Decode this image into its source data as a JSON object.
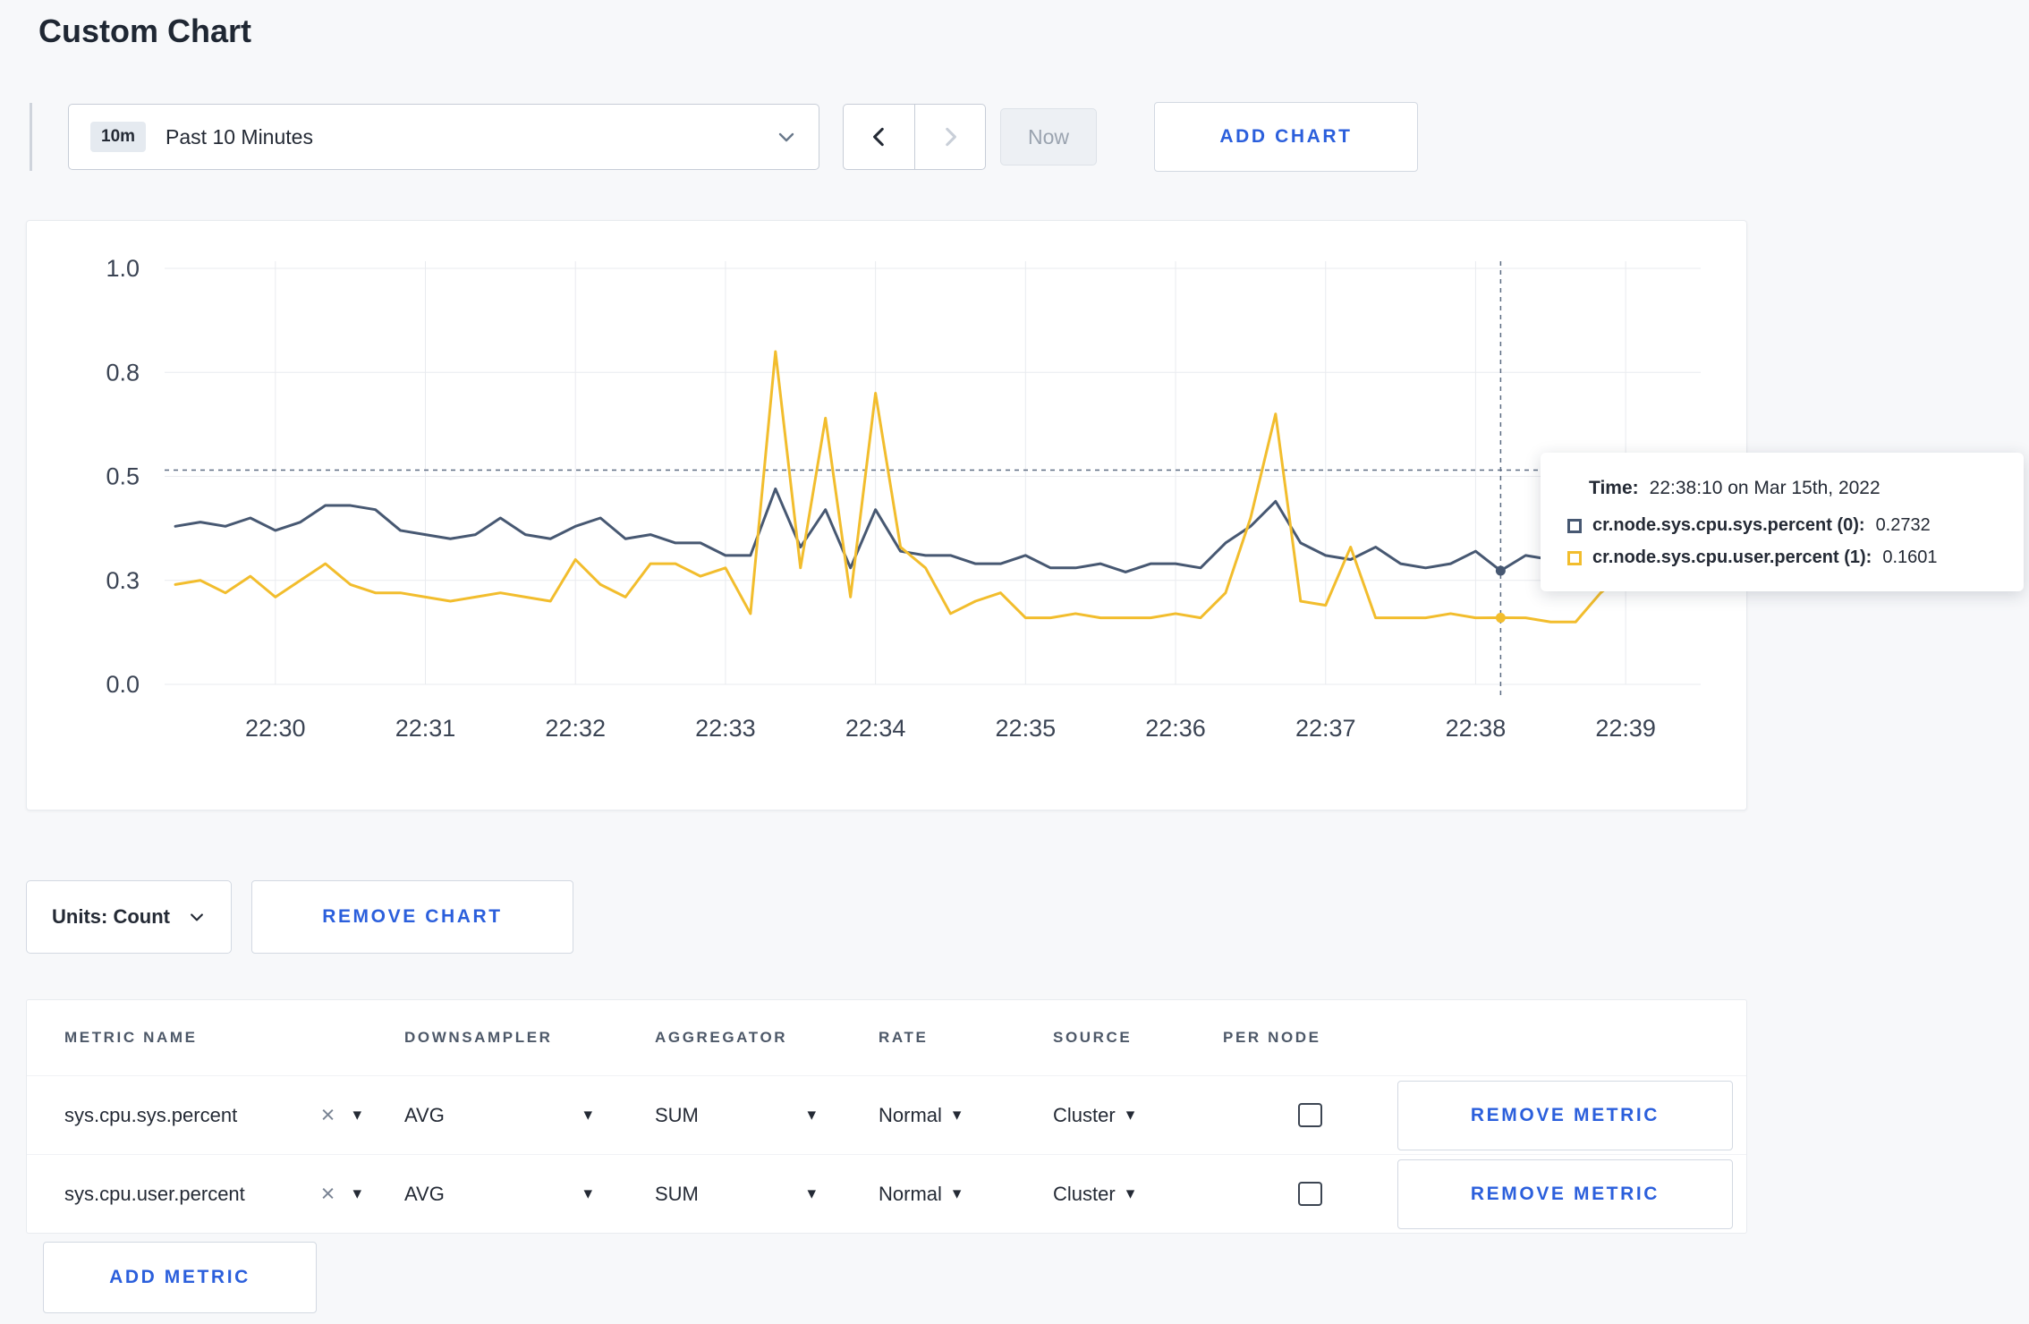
{
  "page": {
    "title": "Custom Chart"
  },
  "colors": {
    "accent_blue": "#2b5fdc",
    "series_sys": "#475872",
    "series_user": "#f2bd2d",
    "page_background": "#f7f8fa"
  },
  "toolbar": {
    "time_range": {
      "badge": "10m",
      "label": "Past 10 Minutes"
    },
    "now_label": "Now",
    "add_chart_label": "ADD CHART"
  },
  "tooltip": {
    "time_label": "Time:",
    "time_value": "22:38:10 on Mar 15th, 2022",
    "rows": [
      {
        "name": "cr.node.sys.cpu.sys.percent (0):",
        "value": "0.2732"
      },
      {
        "name": "cr.node.sys.cpu.user.percent (1):",
        "value": "0.1601"
      }
    ]
  },
  "units": {
    "label": "Units: Count",
    "remove_chart_label": "REMOVE CHART"
  },
  "metrics_table": {
    "headers": [
      "METRIC NAME",
      "DOWNSAMPLER",
      "AGGREGATOR",
      "RATE",
      "SOURCE",
      "PER NODE"
    ],
    "rows": [
      {
        "metric": "sys.cpu.sys.percent",
        "downsampler": "AVG",
        "aggregator": "SUM",
        "rate": "Normal",
        "source": "Cluster",
        "per_node_checked": false,
        "remove_label": "REMOVE METRIC"
      },
      {
        "metric": "sys.cpu.user.percent",
        "downsampler": "AVG",
        "aggregator": "SUM",
        "rate": "Normal",
        "source": "Cluster",
        "per_node_checked": false,
        "remove_label": "REMOVE METRIC"
      }
    ],
    "add_metric_label": "ADD METRIC"
  },
  "chart_data": {
    "type": "line",
    "title": "",
    "xlabel": "",
    "ylabel": "",
    "ylim": [
      0,
      1.0
    ],
    "grid": true,
    "x_ticks": [
      "22:30",
      "22:31",
      "22:32",
      "22:33",
      "22:34",
      "22:35",
      "22:36",
      "22:37",
      "22:38",
      "22:39"
    ],
    "x_tick_indices": [
      4,
      10,
      16,
      22,
      28,
      34,
      40,
      46,
      52,
      58
    ],
    "y_ticks": [
      {
        "value": 0,
        "label": "0.0"
      },
      {
        "value": 0.25,
        "label": "0.3"
      },
      {
        "value": 0.5,
        "label": "0.5"
      },
      {
        "value": 0.75,
        "label": "0.8"
      },
      {
        "value": 1.0,
        "label": "1.0"
      }
    ],
    "series": [
      {
        "name": "cr.node.sys.cpu.sys.percent",
        "color": "#475872",
        "values": [
          0.38,
          0.39,
          0.38,
          0.4,
          0.37,
          0.39,
          0.43,
          0.43,
          0.42,
          0.37,
          0.36,
          0.35,
          0.36,
          0.4,
          0.36,
          0.35,
          0.38,
          0.4,
          0.35,
          0.36,
          0.34,
          0.34,
          0.31,
          0.31,
          0.47,
          0.33,
          0.42,
          0.28,
          0.42,
          0.32,
          0.31,
          0.31,
          0.29,
          0.29,
          0.31,
          0.28,
          0.28,
          0.29,
          0.27,
          0.29,
          0.29,
          0.28,
          0.34,
          0.38,
          0.44,
          0.34,
          0.31,
          0.3,
          0.33,
          0.29,
          0.28,
          0.29,
          0.32,
          0.2732,
          0.31,
          0.3,
          0.3,
          0.31,
          0.3
        ]
      },
      {
        "name": "cr.node.sys.cpu.user.percent",
        "color": "#f2bd2d",
        "values": [
          0.24,
          0.25,
          0.22,
          0.26,
          0.21,
          0.25,
          0.29,
          0.24,
          0.22,
          0.22,
          0.21,
          0.2,
          0.21,
          0.22,
          0.21,
          0.2,
          0.3,
          0.24,
          0.21,
          0.29,
          0.29,
          0.26,
          0.28,
          0.17,
          0.8,
          0.28,
          0.64,
          0.21,
          0.7,
          0.33,
          0.28,
          0.17,
          0.2,
          0.22,
          0.16,
          0.16,
          0.17,
          0.16,
          0.16,
          0.16,
          0.17,
          0.16,
          0.22,
          0.4,
          0.65,
          0.2,
          0.19,
          0.33,
          0.16,
          0.16,
          0.16,
          0.17,
          0.16,
          0.1601,
          0.16,
          0.15,
          0.15,
          0.22,
          0.27
        ]
      }
    ],
    "crosshair": {
      "x_index": 53,
      "y_value": 0.515
    },
    "hover_points": [
      {
        "series": 0,
        "x_index": 53,
        "value": 0.2732
      },
      {
        "series": 1,
        "x_index": 53,
        "value": 0.1601
      }
    ]
  }
}
